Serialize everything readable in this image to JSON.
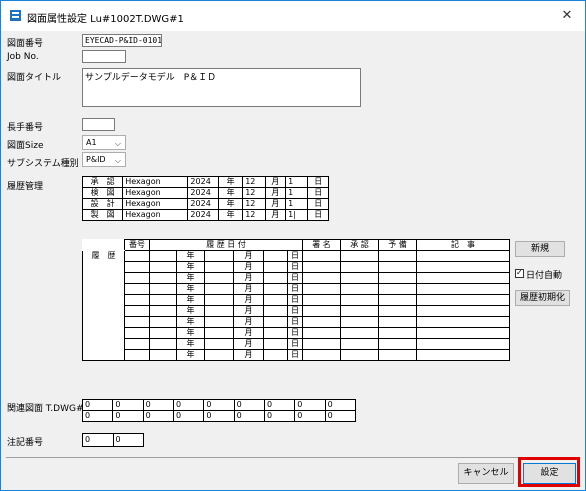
{
  "window": {
    "title": "図面属性設定 Lu#1002T.DWG#1",
    "close_label": "✕"
  },
  "form": {
    "drawing_no_label": "図面番号",
    "drawing_no": "EYECAD-P&ID-0101",
    "job_no_label": "Job No.",
    "job_no": "",
    "title_label": "図面タイトル",
    "title": "サンプルデータモデル　P＆ＩＤ",
    "long_no_label": "長手番号",
    "long_no": "",
    "size_label": "図面Size",
    "size": "A1",
    "subsystem_label": "サブシステム種別",
    "subsystem": "P&ID",
    "history_label": "履歴管理"
  },
  "approvals": [
    {
      "role": "承　認",
      "name": "Hexagon",
      "year": "2024",
      "y": "年",
      "month": "12",
      "m": "月",
      "day": "1",
      "d": "日"
    },
    {
      "role": "検　図",
      "name": "Hexagon",
      "year": "2024",
      "y": "年",
      "month": "12",
      "m": "月",
      "day": "1",
      "d": "日"
    },
    {
      "role": "設　計",
      "name": "Hexagon",
      "year": "2024",
      "y": "年",
      "month": "12",
      "m": "月",
      "day": "1",
      "d": "日"
    },
    {
      "role": "製　図",
      "name": "Hexagon",
      "year": "2024",
      "y": "年",
      "month": "12",
      "m": "月",
      "day": "1|",
      "d": "日"
    }
  ],
  "history": {
    "header": {
      "no": "番号",
      "date": "履 歴 日 付",
      "sign": "署 名",
      "approve": "承 認",
      "reserve": "予 備",
      "notes": "記　事"
    },
    "side_label": "履　歴",
    "rows": [
      {
        "y": "年",
        "m": "月",
        "d": "日"
      },
      {
        "y": "年",
        "m": "月",
        "d": "日"
      },
      {
        "y": "年",
        "m": "月",
        "d": "日"
      },
      {
        "y": "年",
        "m": "月",
        "d": "日"
      },
      {
        "y": "年",
        "m": "月",
        "d": "日"
      },
      {
        "y": "年",
        "m": "月",
        "d": "日"
      },
      {
        "y": "年",
        "m": "月",
        "d": "日"
      },
      {
        "y": "年",
        "m": "月",
        "d": "日"
      },
      {
        "y": "年",
        "m": "月",
        "d": "日"
      },
      {
        "y": "年",
        "m": "月",
        "d": "日"
      }
    ]
  },
  "side_buttons": {
    "new": "新規",
    "auto_date": "日付自動",
    "init": "履歴初期化"
  },
  "related": {
    "label": "関連図面 T.DWG#",
    "values": [
      "0",
      "0",
      "0",
      "0",
      "0",
      "0",
      "0",
      "0",
      "0"
    ]
  },
  "note": {
    "label": "注記番号",
    "values": [
      "0",
      "0"
    ]
  },
  "footer": {
    "cancel": "キャンセル",
    "ok": "設定"
  }
}
